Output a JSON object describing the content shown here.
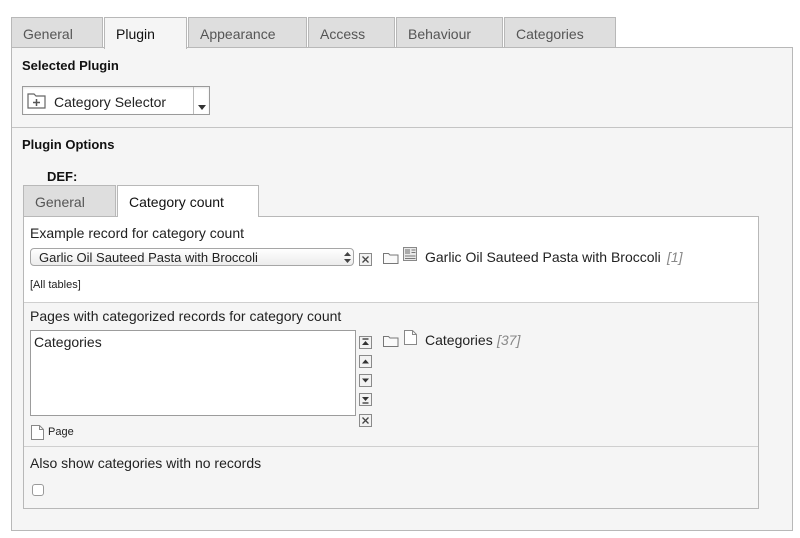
{
  "tabs": [
    "General",
    "Plugin",
    "Appearance",
    "Access",
    "Behaviour",
    "Categories"
  ],
  "selected_plugin": {
    "heading": "Selected Plugin",
    "value": "Category Selector"
  },
  "plugin_options": {
    "heading": "Plugin Options",
    "def_label": "DEF:"
  },
  "inner_tabs": [
    "General",
    "Category count"
  ],
  "example_record": {
    "label": "Example record for category count",
    "select_value": "Garlic Oil Sauteed Pasta with Broccoli",
    "record_title": "Garlic Oil Sauteed Pasta with Broccoli",
    "record_uid": "[1]",
    "tables_note": "[All tables]"
  },
  "pages": {
    "label": "Pages with categorized records for category count",
    "list_item": "Categories",
    "record_title": "Categories",
    "record_uid": "[37]",
    "type_label": "Page"
  },
  "empty_categories": {
    "label": "Also show categories with no records",
    "checked": false
  }
}
